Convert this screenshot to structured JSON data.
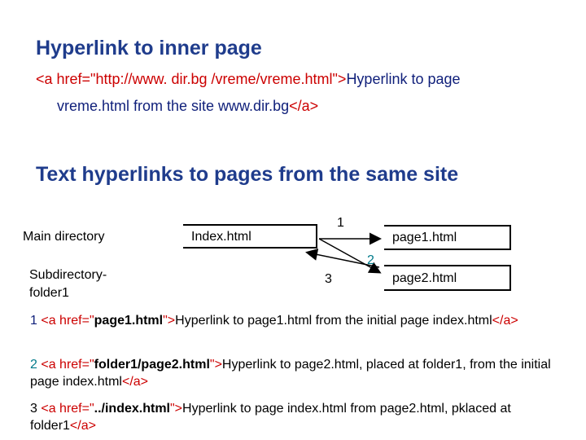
{
  "section1": {
    "title": "Hyperlink to inner page",
    "line1_tag": "<a href=\"http://www. dir.bg /vreme/vreme.html\">",
    "line1_text": "Hyperlink to page",
    "line2_text": "vreme.html from the site www.dir.bg",
    "line2_close": "</a>"
  },
  "section2": {
    "title": "Text hyperlinks to pages from the same site"
  },
  "diagram": {
    "main_dir_label": "Main  directory",
    "subdir_label": "Subdirectory-\nfolder1",
    "index_label": "Index.html",
    "page1_label": "page1.html",
    "page2_label": "page2.html",
    "arrow1_label": "1",
    "arrow2_label": "2",
    "arrow3_label": "3",
    "arrow2_color": "#007a8a"
  },
  "examples": [
    {
      "num": "1",
      "open": "<a href=\"",
      "href": "page1.html",
      "close_quote": "\">",
      "text": "Hyperlink to page1.html from the initial page index.html",
      "end": "</a>",
      "color": "#000000"
    },
    {
      "num": "2",
      "open": "<a href=\"",
      "href": "folder1/page2.html",
      "close_quote": "\">",
      "text": "Hyperlink to page2.html, placed at folder1, from the initial page index.html",
      "end": "</a>",
      "color": "#007a8a"
    },
    {
      "num": "3",
      "open": "<a href=\"",
      "href": "../index.html",
      "close_quote": "\">",
      "text": "Hyperlink to page index.html from page2.html, pklaced at folder1",
      "end": "</a>",
      "color": "#000000"
    }
  ]
}
